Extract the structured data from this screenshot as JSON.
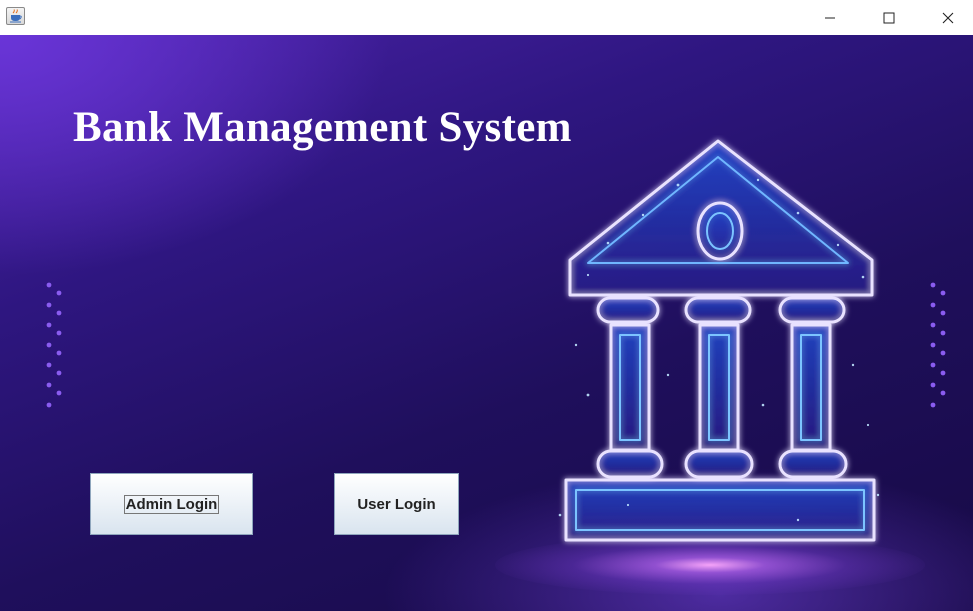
{
  "window": {
    "app_icon": "java-coffee-cup-icon",
    "controls": [
      "minimize-icon",
      "maximize-icon",
      "close-icon"
    ]
  },
  "main": {
    "title": "Bank Management System",
    "illustration": "bank-building-icon",
    "buttons": {
      "admin_login": "Admin Login",
      "user_login": "User Login"
    }
  },
  "colors": {
    "background_dark": "#1f0f5c",
    "background_accent": "#6a35d8",
    "building_glow": "#4aa8ff",
    "building_outline": "#e6ddff",
    "title_text": "#ffffff"
  }
}
